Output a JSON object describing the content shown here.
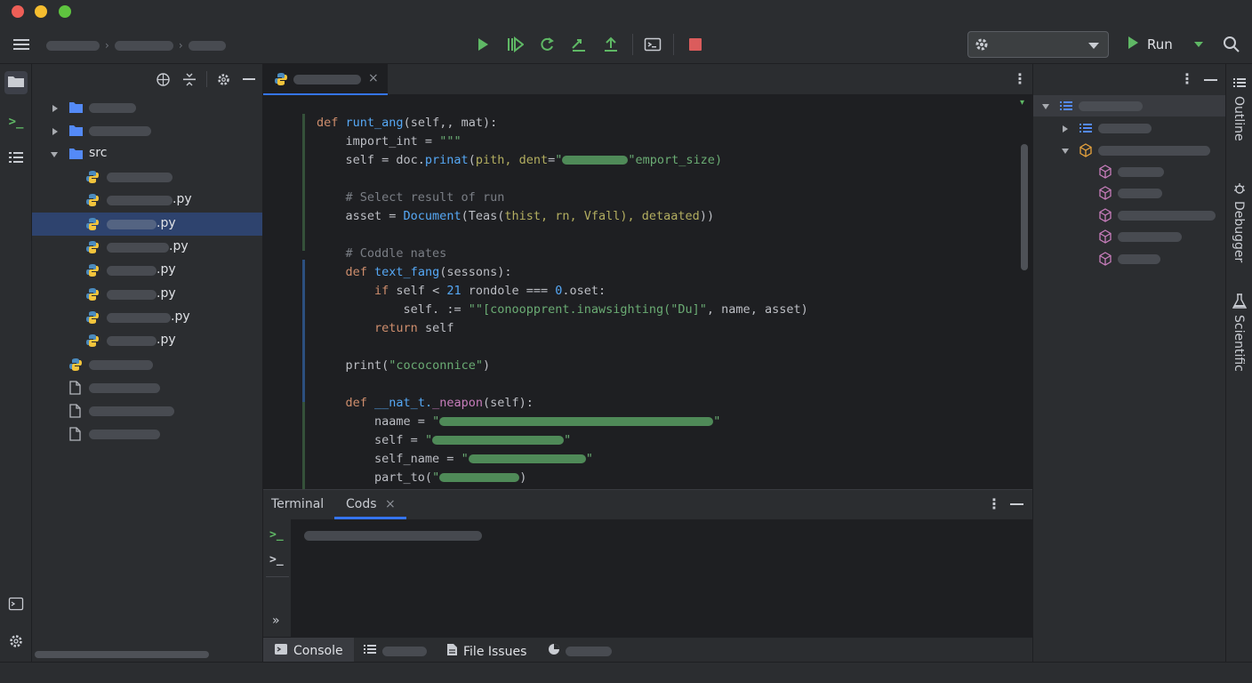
{
  "window": {
    "traffic_lights": [
      "#ee5f57",
      "#f5bd2f",
      "#5fc43f"
    ]
  },
  "toolbar": {
    "run_label": "Run",
    "icons": [
      "menu-icon",
      "play-icon",
      "resume-icon",
      "rerun-icon",
      "step-icon",
      "upload-icon",
      "terminal-icon",
      "stop-icon",
      "gear-icon",
      "chevron-down-icon",
      "search-icon"
    ]
  },
  "project": {
    "items": [
      {
        "label": "",
        "type": "folder",
        "state": "collapsed"
      },
      {
        "label": "",
        "type": "folder",
        "state": "collapsed"
      },
      {
        "label": "src",
        "type": "folder",
        "state": "expanded"
      },
      {
        "label": "",
        "type": "python"
      },
      {
        "label": ".py",
        "type": "python"
      },
      {
        "label": ".py",
        "type": "python",
        "selected": true
      },
      {
        "label": ".py",
        "type": "python"
      },
      {
        "label": ".py",
        "type": "python"
      },
      {
        "label": ".py",
        "type": "python"
      },
      {
        "label": ".py",
        "type": "python"
      },
      {
        "label": ".py",
        "type": "python"
      },
      {
        "label": "",
        "type": "python"
      },
      {
        "label": "",
        "type": "file"
      },
      {
        "label": "",
        "type": "file"
      },
      {
        "label": "",
        "type": "file"
      }
    ]
  },
  "editor": {
    "code": {
      "l1_kw": "def",
      "l1_fn": "runt_ang",
      "l1_rest": "(self,, mat):",
      "l2": "import_int = ",
      "l2_str": "\"\"\"",
      "l3a": "self = doc.",
      "l3_fn": "prinat",
      "l3b": "(",
      "l3_p": "pith, dent",
      "l3c": "=",
      "l3_s1": "\"",
      "l3_s2": "\"emport_size)",
      "l5": "# Select result of run",
      "l6a": "asset = ",
      "l6_fn": "Document",
      "l6b": "(Teas(",
      "l6_p": "thist, rn, Vfall), detaated",
      "l6c": "))",
      "l8": "# Coddle nates",
      "l9_kw": "def",
      "l9_fn": "text_fang",
      "l9_rest": "(sessons):",
      "l10_kw": "if",
      "l10_rest": " self < ",
      "l10_num": "21",
      "l10_b": " rondole === ",
      "l10_num2": "0",
      "l10_c": ".oset:",
      "l11a": "self. := ",
      "l11_s": "\"\"[conoopprent.inawsighting(\"Du]\"",
      "l11b": ", name, asset)",
      "l12_kw": "return",
      "l12_rest": " self",
      "l14a": "print(",
      "l14_s": "\"cococonnice\"",
      "l14b": ")",
      "l16_kw": "def",
      "l16_fn": "__nat_t.",
      "l16_sc": "_neapon",
      "l16_rest": "(self):",
      "l17": "naame = ",
      "l17_s": "\"",
      "l17_e": "\"",
      "l18": "self = ",
      "l18_s": "\"",
      "l18_e": "\"",
      "l19": "self_name = ",
      "l19_s": "\"",
      "l19_e": "\"",
      "l20": "part_to(",
      "l20_s": "\"",
      "l20_e": ")"
    }
  },
  "bottom": {
    "tabs": [
      "Terminal",
      "Cods"
    ],
    "footer": {
      "console": "Console",
      "file_issues": "File Issues"
    }
  },
  "sidebar_right": {
    "outline": "Outline",
    "debugger": "Debugger",
    "scientific": "Scientific"
  },
  "colors": {
    "accent": "#3574f0",
    "run_green": "#5fb865",
    "stop_red": "#db5c5c",
    "python_blue": "#4b8bbe",
    "python_yellow": "#f2c43c"
  }
}
